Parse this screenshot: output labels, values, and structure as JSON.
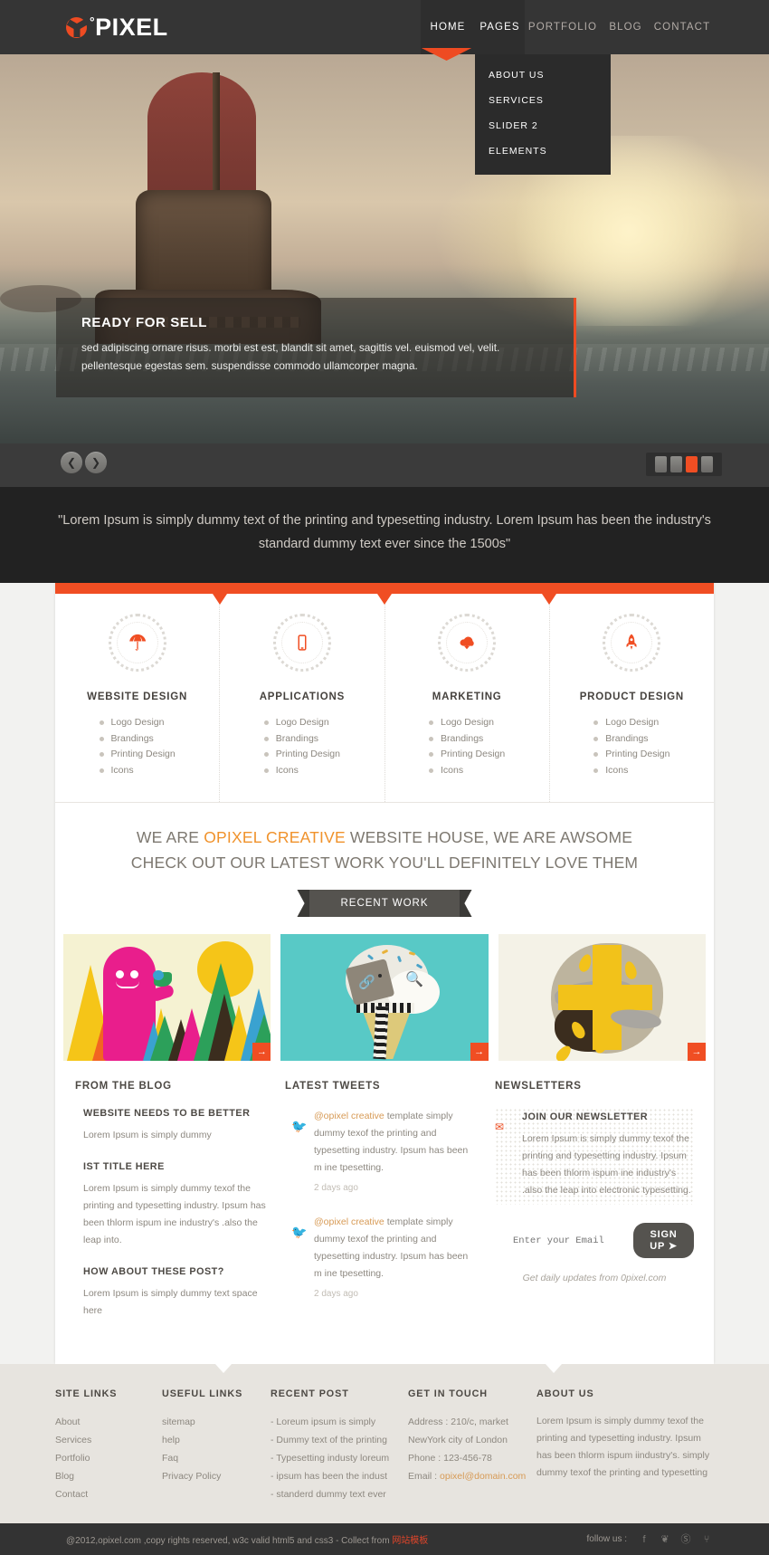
{
  "header": {
    "logo_text": "PIXEL",
    "logo_degree": "°",
    "logo_icon": "radiation-logo-icon",
    "nav": [
      {
        "label": "HOME",
        "active": true
      },
      {
        "label": "PAGES",
        "active": true
      },
      {
        "label": "PORTFOLIO",
        "active": false
      },
      {
        "label": "BLOG",
        "active": false
      },
      {
        "label": "CONTACT",
        "active": false
      }
    ],
    "dropdown": [
      "ABOUT US",
      "SERVICES",
      "SLIDER 2",
      "ELEMENTS"
    ]
  },
  "hero": {
    "caption_title": "READY FOR SELL",
    "caption_text": "sed adipiscing ornare risus. morbi est est, blandit sit amet, sagittis vel. euismod vel, velit. pellentesque egestas sem. suspendisse commodo ullamcorper magna.",
    "prev_icon": "chevron-left-icon",
    "next_icon": "chevron-right-icon",
    "pager": {
      "count": 4,
      "active_index": 2
    }
  },
  "quote": {
    "text": "\"Lorem Ipsum is simply dummy text of the printing and typesetting industry. Lorem Ipsum has been the industry's standard dummy text ever since the 1500s\""
  },
  "services": [
    {
      "icon": "umbrella-icon",
      "title": "WEBSITE DESIGN",
      "items": [
        "Logo Design",
        "Brandings",
        "Printing Design",
        "Icons"
      ]
    },
    {
      "icon": "mobile-phone-icon",
      "title": "APPLICATIONS",
      "items": [
        "Logo Design",
        "Brandings",
        "Printing Design",
        "Icons"
      ]
    },
    {
      "icon": "cloud-download-icon",
      "title": "MARKETING",
      "items": [
        "Logo Design",
        "Brandings",
        "Printing Design",
        "Icons"
      ]
    },
    {
      "icon": "rocket-icon",
      "title": "PRODUCT DESIGN",
      "items": [
        "Logo Design",
        "Brandings",
        "Printing Design",
        "Icons"
      ]
    }
  ],
  "headline": {
    "part1": "WE ARE ",
    "highlight": "OPIXEL CREATIVE",
    "part2": " WEBSITE HOUSE, WE ARE AWSOME CHECK OUT OUR LATEST WORK YOU'LL DEFINITELY LOVE THEM",
    "ribbon_label": "RECENT WORK"
  },
  "portfolio": {
    "more_icon": "arrow-right-icon",
    "items": [
      {
        "name": "mountains-monster-illustration"
      },
      {
        "name": "ice-cream-cone-illustration",
        "link_icon": "link-icon",
        "zoom_icon": "magnifier-icon"
      },
      {
        "name": "abstract-yellow-head-illustration"
      }
    ]
  },
  "blog": {
    "title": "FROM THE BLOG",
    "posts": [
      {
        "title": "WEBSITE NEEDS TO BE BETTER",
        "text": "Lorem Ipsum is simply dummy"
      },
      {
        "title": "IST TITLE HERE",
        "text": "Lorem Ipsum is simply dummy texof the printing and typesetting industry. Ipsum has been thlorm ispum ine industry's .also the leap into."
      },
      {
        "title": "HOW ABOUT THESE POST?",
        "text": "Lorem Ipsum is simply dummy text space here"
      }
    ]
  },
  "tweets": {
    "title": "LATEST TWEETS",
    "items": [
      {
        "icon": "twitter-bird-icon",
        "color": "orange",
        "handle": "@opixel creative",
        "text": " template simply dummy texof the printing and typesetting industry. Ipsum has been m ine tpesetting.",
        "ago": "2 days ago"
      },
      {
        "icon": "twitter-bird-icon",
        "color": "gray",
        "handle": "@opixel creative",
        "text": " template simply dummy texof the printing and typesetting industry. Ipsum has been m ine tpesetting.",
        "ago": "2 days ago"
      }
    ]
  },
  "newsletter": {
    "title": "NEWSLETTERS",
    "icon": "envelope-icon",
    "box_title": "JOIN OUR NEWSLETTER",
    "box_text": "Lorem Ipsum is simply dummy texof the printing and typesetting industry. Ipsum has been thlorm ispum ine industry's .also the leap into electronic typesetting.",
    "input_placeholder": "Enter your Email",
    "input_value": "",
    "signup_label": "SIGN UP",
    "signup_icon": "arrow-icon",
    "note": "Get daily updates from 0pixel.com"
  },
  "footer": {
    "columns": [
      {
        "title": "SITE LINKS",
        "links": [
          "About",
          "Services",
          "Portfolio",
          "Blog",
          "Contact"
        ]
      },
      {
        "title": "USEFUL LINKS",
        "links": [
          "sitemap",
          "help",
          "Faq",
          "Privacy Policy"
        ]
      },
      {
        "title": "RECENT POST",
        "links": [
          "- Loreum ipsum is simply",
          "- Dummy text of the printing",
          "- Typesetting industy loreum",
          "- ipsum has been the indust",
          "- standerd dummy text ever"
        ]
      }
    ],
    "contact": {
      "title": "GET IN TOUCH",
      "address1": "Address : 210/c, market",
      "address2": "NewYork city of London",
      "phone": "Phone : 123-456-78",
      "email_label": "Email : ",
      "email": "opixel@domain.com"
    },
    "about": {
      "title": "ABOUT US",
      "text": "Lorem Ipsum is simply dummy texof the printing and typesetting industry. Ipsum has been thlorm ispum iindustry's. simply dummy texof the printing and typesetting"
    }
  },
  "copyright": {
    "text": "@2012,opixel.com ,copy rights reserved, w3c valid html5 and css3 - Collect from ",
    "link": "网站模板",
    "follow_label": "follow us :",
    "social": [
      {
        "name": "facebook-icon",
        "glyph": "f"
      },
      {
        "name": "twitter-icon",
        "glyph": "❦"
      },
      {
        "name": "stumbleupon-icon",
        "glyph": "Ⓢ"
      },
      {
        "name": "rss-icon",
        "glyph": "⑂"
      }
    ]
  },
  "colors": {
    "accent": "#f04e23",
    "dark": "#353535",
    "quote_bg": "#222222",
    "highlight": "#f0922b"
  }
}
